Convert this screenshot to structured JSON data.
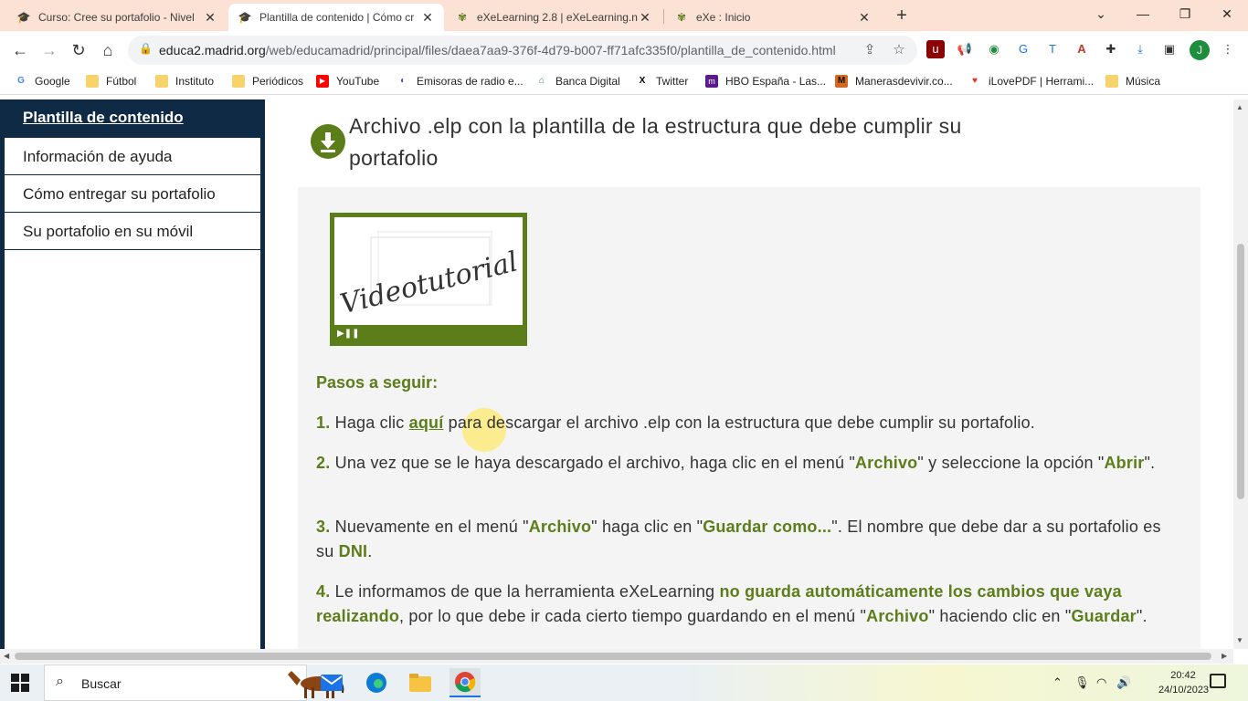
{
  "browser": {
    "tabs": [
      {
        "title": "Curso: Cree su portafolio - Nivel",
        "icon": "graduation-cap-icon",
        "active": false
      },
      {
        "title": "Plantilla de contenido | Cómo cr",
        "icon": "graduation-cap-icon",
        "active": true
      },
      {
        "title": "eXeLearning 2.8 | eXeLearning.n",
        "icon": "exe-butterfly-icon",
        "active": false
      },
      {
        "title": "eXe : Inicio",
        "icon": "exe-butterfly-icon",
        "active": false
      }
    ],
    "new_tab_label": "+",
    "url_host": "educa2.madrid.org",
    "url_path": "/web/educamadrid/principal/files/daea7aa9-376f-4d79-b007-ff71afc335f0/plantilla_de_contenido.html",
    "profile_initial": "J",
    "bookmarks": [
      {
        "label": "Google",
        "icon": "google-icon",
        "color": "#4285f4"
      },
      {
        "label": "Fútbol",
        "icon": "folder-icon",
        "color": "#f6d36b"
      },
      {
        "label": "Instituto",
        "icon": "folder-icon",
        "color": "#f6d36b"
      },
      {
        "label": "Periódicos",
        "icon": "folder-icon",
        "color": "#f6d36b"
      },
      {
        "label": "YouTube",
        "icon": "youtube-icon",
        "color": "#ff0000"
      },
      {
        "label": "Emisoras de radio e...",
        "icon": "radio-icon",
        "color": "#6a3fbf"
      },
      {
        "label": "Banca Digital",
        "icon": "bank-icon",
        "color": "#2e8b57"
      },
      {
        "label": "Twitter",
        "icon": "x-icon",
        "color": "#000000"
      },
      {
        "label": "HBO España - Las...",
        "icon": "hbo-icon",
        "color": "#5a1a8a"
      },
      {
        "label": "Manerasdevivir.co...",
        "icon": "m-logo-icon",
        "color": "#d2691e"
      },
      {
        "label": "iLovePDF | Herrami...",
        "icon": "heart-icon",
        "color": "#e5322d"
      },
      {
        "label": "Música",
        "icon": "folder-icon",
        "color": "#f6d36b"
      }
    ]
  },
  "sidebar": {
    "current": "Plantilla de contenido",
    "items": [
      {
        "label": "Información de ayuda"
      },
      {
        "label": "Cómo entregar su portafolio"
      },
      {
        "label": "Su portafolio en su móvil"
      }
    ]
  },
  "content": {
    "heading_line1": "Archivo .elp con la plantilla de la estructura que debe cumplir su",
    "heading_line2": "portafolio",
    "video_label": "Videotutorial",
    "steps_title": "Pasos a seguir:",
    "step1": {
      "num": "1.",
      "pre": " Haga clic ",
      "link": "aquí",
      "post": " para descargar el archivo .elp con la estructura que debe cumplir su portafolio."
    },
    "step2": {
      "num": "2.",
      "a": " Una vez que se le haya descargado el archivo, haga clic en el menú \"",
      "b1": "Archivo",
      "c": "\" y seleccione la opción \"",
      "b2": "Abrir",
      "d": "\"."
    },
    "step3": {
      "num": "3.",
      "a": " Nuevamente en el menú \"",
      "b1": "Archivo",
      "c": "\" haga clic en \"",
      "b2": "Guardar como...",
      "d": "\". El nombre que debe dar a su portafolio es su ",
      "b3": "DNI",
      "e": "."
    },
    "step4": {
      "num": "4.",
      "a": " Le informamos de que la herramienta eXeLearning ",
      "b1": "no guarda automáticamente los cambios que vaya realizando",
      "c": ", por lo que debe ir cada cierto tiempo guardando en el menú \"",
      "b2": "Archivo",
      "d": "\" haciendo clic en \"",
      "b3": "Guardar",
      "e": "\"."
    }
  },
  "taskbar": {
    "search_placeholder": "Buscar",
    "time": "20:42",
    "date": "24/10/2023"
  },
  "colors": {
    "accent_green": "#5b7d1a",
    "sidebar_navy": "#0f2a44"
  }
}
